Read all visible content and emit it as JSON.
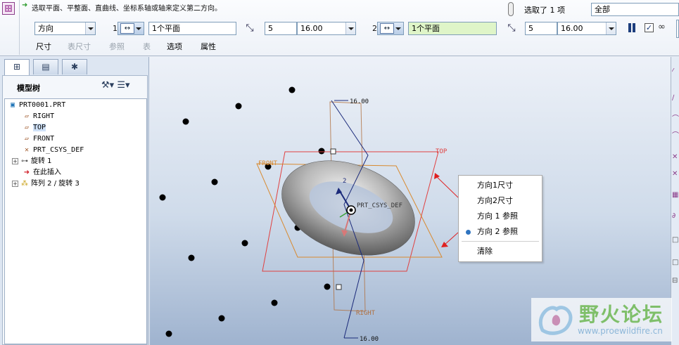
{
  "dashboard": {
    "status_message": "选取平面、平整面、直曲线、坐标系轴或轴来定义第二方向。",
    "type_select": "方向",
    "dir1": {
      "number": "1",
      "reference": "1个平面",
      "count": "5",
      "spacing": "16.00"
    },
    "dir2": {
      "number": "2",
      "reference": "1个平面",
      "count": "5",
      "spacing": "16.00"
    },
    "tabs": [
      {
        "label": "尺寸",
        "enabled": true
      },
      {
        "label": "表尺寸",
        "enabled": false
      },
      {
        "label": "参照",
        "enabled": false
      },
      {
        "label": "表",
        "enabled": false
      },
      {
        "label": "选项",
        "enabled": true
      },
      {
        "label": "属性",
        "enabled": true
      }
    ],
    "selection_count": "选取了 1 项",
    "filter": "全部",
    "preview_checked": "✓"
  },
  "navigator": {
    "tabs": [
      "model-tree",
      "folder-browser",
      "favorites"
    ],
    "title": "模型树",
    "tree": [
      {
        "label": "PRT0001.PRT",
        "icon": "part-icon"
      },
      {
        "label": "RIGHT",
        "icon": "datum-plane-icon"
      },
      {
        "label": "TOP",
        "icon": "datum-plane-icon",
        "selected": true
      },
      {
        "label": "FRONT",
        "icon": "datum-plane-icon"
      },
      {
        "label": "PRT_CSYS_DEF",
        "icon": "csys-icon"
      },
      {
        "label": "旋转 1",
        "icon": "revolve-icon",
        "expandable": true
      },
      {
        "label": "在此插入",
        "icon": "insert-arrow-icon"
      },
      {
        "label": "阵列 2 / 旋转 3",
        "icon": "pattern-icon",
        "expandable": true
      }
    ]
  },
  "graphics": {
    "dimension_labels": [
      "16.00",
      "16.00"
    ],
    "plane_labels": {
      "top": "TOP",
      "front": "FRONT",
      "right": "RIGHT",
      "csys": "PRT_CSYS_DEF"
    },
    "axis_labels": {
      "y": "2",
      "x": "1"
    }
  },
  "context_menu": {
    "items": [
      {
        "label": "方向1尺寸",
        "active": false
      },
      {
        "label": "方向2尺寸",
        "active": false
      },
      {
        "label": "方向 1 参照",
        "active": false
      },
      {
        "label": "方向 2 参照",
        "active": true
      },
      {
        "label": "清除",
        "active": false
      }
    ]
  },
  "watermark": {
    "title": "野火论坛",
    "url": "www.proewildfire.cn"
  }
}
